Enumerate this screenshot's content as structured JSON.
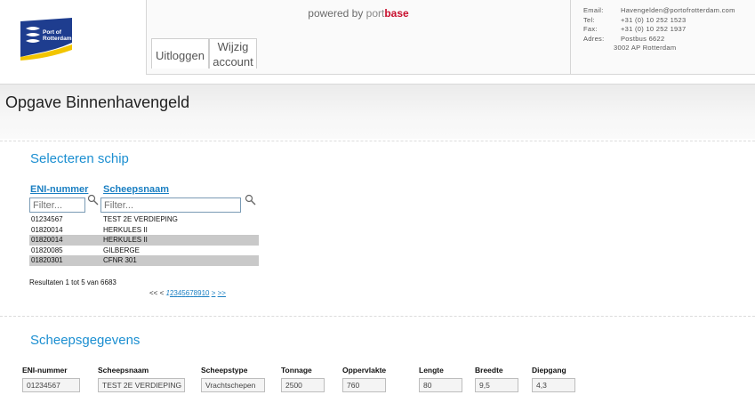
{
  "header": {
    "logo_text_line1": "Port of",
    "logo_text_line2": "Rotterdam",
    "powered_prefix": "powered by ",
    "powered_brand_a": "port",
    "powered_brand_b": "base",
    "logout_label": "Uitloggen",
    "account_label_line1": "Wijzig",
    "account_label_line2": "account",
    "contact": {
      "email_key": "Email:",
      "email_value": "Havengelden@portofrotterdam.com",
      "tel_key": "Tel:",
      "tel_value": "+31 (0) 10 252 1523",
      "fax_key": "Fax:",
      "fax_value": "+31 (0) 10 252 1937",
      "adres_key": "Adres:",
      "adres_value_line1": "Postbus 6622",
      "adres_value_line2": "3002 AP  Rotterdam"
    }
  },
  "page": {
    "title": "Opgave Binnenhavengeld"
  },
  "select_ship": {
    "title": "Selecteren schip",
    "col_eni": "ENI-nummer",
    "col_naam": "Scheepsnaam",
    "filter_eni_placeholder": "Filter...",
    "filter_naam_placeholder": "Filter...",
    "rows": [
      {
        "eni": "01234567",
        "naam": "TEST 2E VERDIEPING",
        "shaded": false
      },
      {
        "eni": "01820014",
        "naam": "HERKULES II",
        "shaded": false
      },
      {
        "eni": "01820014",
        "naam": "HERKULES II",
        "shaded": true
      },
      {
        "eni": "01820085",
        "naam": "GILBERGE",
        "shaded": false
      },
      {
        "eni": "01820301",
        "naam": "CFNR 301",
        "shaded": true
      }
    ],
    "result_text": "Resultaten 1 tot 5 van 6683",
    "pager": {
      "first": "<<",
      "prev": "<",
      "current": "1",
      "pages": [
        "2",
        "3",
        "4",
        "5",
        "6",
        "7",
        "8",
        "9",
        "10"
      ],
      "next": ">",
      "last": ">>"
    }
  },
  "ship_details": {
    "title": "Scheepsgegevens",
    "fields": [
      {
        "label": "ENI-nummer",
        "value": "01234567"
      },
      {
        "label": "Scheepsnaam",
        "value": "TEST 2E VERDIEPING"
      },
      {
        "label": "Scheepstype",
        "value": "Vrachtschepen"
      },
      {
        "label": "Tonnage",
        "value": "2500"
      },
      {
        "label": "Oppervlakte",
        "value": "760"
      },
      {
        "label": "Lengte",
        "value": "80"
      },
      {
        "label": "Breedte",
        "value": "9,5"
      },
      {
        "label": "Diepgang",
        "value": "4,3"
      }
    ]
  },
  "colors": {
    "accent": "#1c8fd1",
    "brand_red": "#c8102e",
    "logo_navy": "#1e3d8f",
    "logo_yellow": "#f2c500"
  }
}
